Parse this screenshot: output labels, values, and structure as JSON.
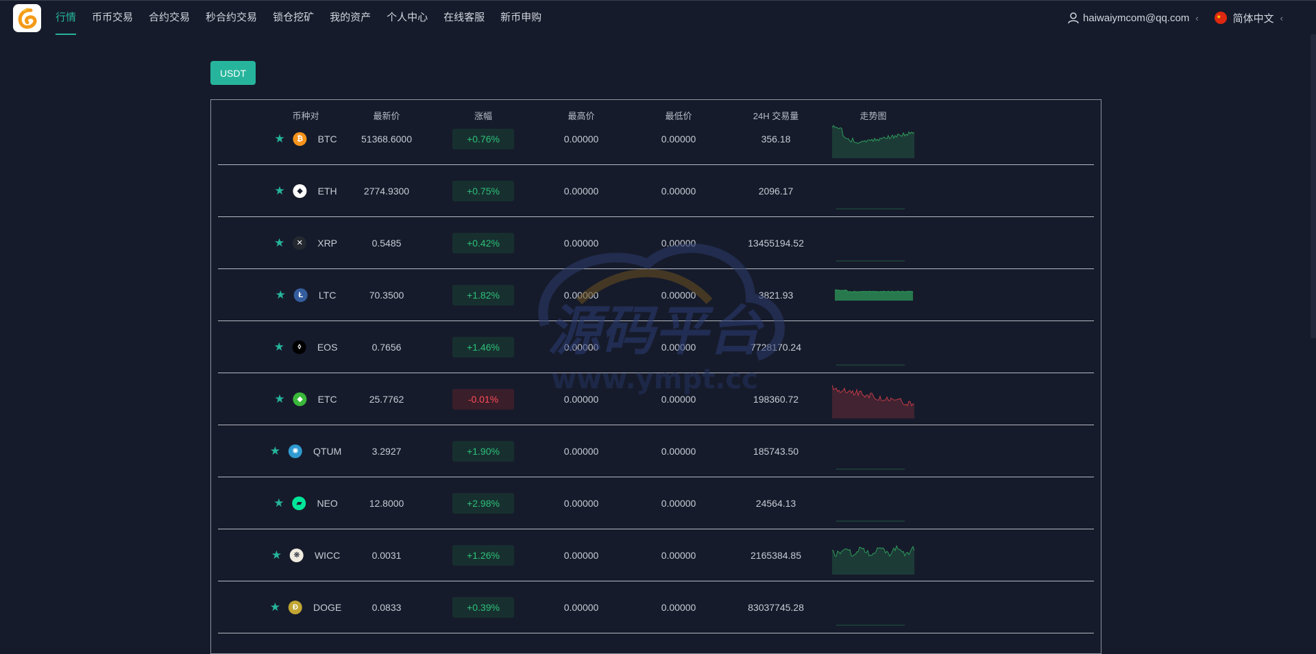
{
  "nav": {
    "items": [
      "行情",
      "币币交易",
      "合约交易",
      "秒合约交易",
      "锁仓挖矿",
      "我的资产",
      "个人中心",
      "在线客服",
      "新币申购"
    ],
    "active_index": 0
  },
  "user": {
    "email": "haiwaiymcom@qq.com",
    "language": "简体中文"
  },
  "market_tab": "USDT",
  "table": {
    "headers": [
      "币种对",
      "最新价",
      "涨幅",
      "最高价",
      "最低价",
      "24H 交易量",
      "走势图"
    ],
    "rows": [
      {
        "symbol": "BTC",
        "price": "51368.6000",
        "change": "+0.76%",
        "direction": "up",
        "high": "0.00000",
        "low": "0.00000",
        "volume": "356.18",
        "icon": "bitcoin-icon",
        "icon_color": "#f7931a",
        "icon_glyph": "₿",
        "trend": "up-noisy"
      },
      {
        "symbol": "ETH",
        "price": "2774.9300",
        "change": "+0.75%",
        "direction": "up",
        "high": "0.00000",
        "low": "0.00000",
        "volume": "2096.17",
        "icon": "ethereum-icon",
        "icon_color": "#ffffff",
        "icon_glyph": "◆",
        "trend": "flat"
      },
      {
        "symbol": "XRP",
        "price": "0.5485",
        "change": "+0.42%",
        "direction": "up",
        "high": "0.00000",
        "low": "0.00000",
        "volume": "13455194.52",
        "icon": "xrp-icon",
        "icon_color": "#23292f",
        "icon_glyph": "✕",
        "trend": "flat"
      },
      {
        "symbol": "LTC",
        "price": "70.3500",
        "change": "+1.82%",
        "direction": "up",
        "high": "0.00000",
        "low": "0.00000",
        "volume": "3821.93",
        "icon": "litecoin-icon",
        "icon_color": "#345d9d",
        "icon_glyph": "Ł",
        "trend": "up-block"
      },
      {
        "symbol": "EOS",
        "price": "0.7656",
        "change": "+1.46%",
        "direction": "up",
        "high": "0.00000",
        "low": "0.00000",
        "volume": "7728170.24",
        "icon": "eos-icon",
        "icon_color": "#000000",
        "icon_glyph": "⬨",
        "trend": "flat"
      },
      {
        "symbol": "ETC",
        "price": "25.7762",
        "change": "-0.01%",
        "direction": "down",
        "high": "0.00000",
        "low": "0.00000",
        "volume": "198360.72",
        "icon": "etc-icon",
        "icon_color": "#3ab83a",
        "icon_glyph": "◆",
        "trend": "down-noisy"
      },
      {
        "symbol": "QTUM",
        "price": "3.2927",
        "change": "+1.90%",
        "direction": "up",
        "high": "0.00000",
        "low": "0.00000",
        "volume": "185743.50",
        "icon": "qtum-icon",
        "icon_color": "#2e9ad0",
        "icon_glyph": "✺",
        "trend": "flat"
      },
      {
        "symbol": "NEO",
        "price": "12.8000",
        "change": "+2.98%",
        "direction": "up",
        "high": "0.00000",
        "low": "0.00000",
        "volume": "24564.13",
        "icon": "neo-icon",
        "icon_color": "#00e599",
        "icon_glyph": "▰",
        "trend": "flat"
      },
      {
        "symbol": "WICC",
        "price": "0.0031",
        "change": "+1.26%",
        "direction": "up",
        "high": "0.00000",
        "low": "0.00000",
        "volume": "2165384.85",
        "icon": "wicc-icon",
        "icon_color": "#f0ebe0",
        "icon_glyph": "❋",
        "trend": "up-wave"
      },
      {
        "symbol": "DOGE",
        "price": "0.0833",
        "change": "+0.39%",
        "direction": "up",
        "high": "0.00000",
        "low": "0.00000",
        "volume": "83037745.28",
        "icon": "dogecoin-icon",
        "icon_color": "#c2a633",
        "icon_glyph": "Ð",
        "trend": "flat"
      }
    ]
  },
  "watermark": {
    "text": "源码平台",
    "url": "www.ympt.cc"
  },
  "colors": {
    "accent": "#26b59c",
    "up": "#2ec07a",
    "down": "#ff4d5a",
    "background": "#161b2b"
  }
}
